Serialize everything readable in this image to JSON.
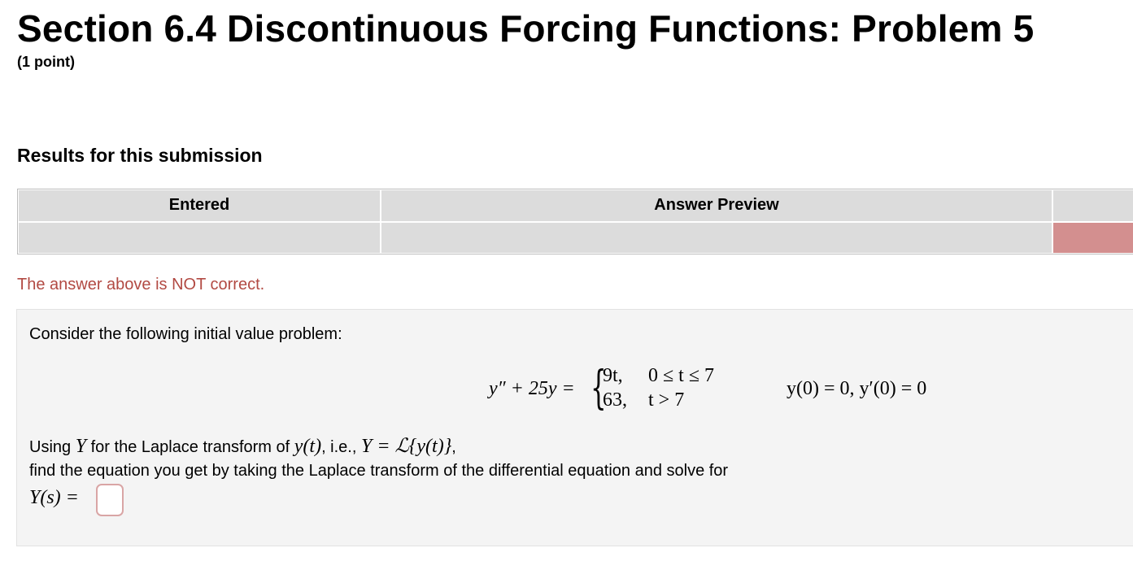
{
  "page": {
    "title": "Section 6.4 Discontinuous Forcing Functions: Problem 5",
    "points": "(1 point)"
  },
  "results": {
    "heading": "Results for this submission",
    "columns": [
      "Entered",
      "Answer Preview",
      ""
    ],
    "row": {
      "entered": "",
      "preview": "",
      "status": ""
    },
    "status_color": "#d38f8f",
    "feedback": "The answer above is NOT correct.",
    "feedback_color": "#b24a43"
  },
  "problem": {
    "intro": "Consider the following initial value problem:",
    "equation": {
      "lhs": "y″ + 25y =",
      "case1_value": "9t,",
      "case1_condition": "0 ≤ t ≤ 7",
      "case2_value": "63,",
      "case2_condition": "t > 7",
      "initial_conditions": "y(0) = 0,  y′(0) = 0"
    },
    "instruction_line1_a": "Using ",
    "instruction_Y": "Y",
    "instruction_line1_b": " for the Laplace transform of ",
    "instruction_yt": "y(t)",
    "instruction_line1_c": ", i.e., ",
    "instruction_def": "Y = ℒ{y(t)}",
    "instruction_line1_d": ",",
    "instruction_line2": "find the equation you get by taking the Laplace transform of the differential equation and solve for",
    "answer_label": "Y(s) =",
    "answer_value": ""
  }
}
